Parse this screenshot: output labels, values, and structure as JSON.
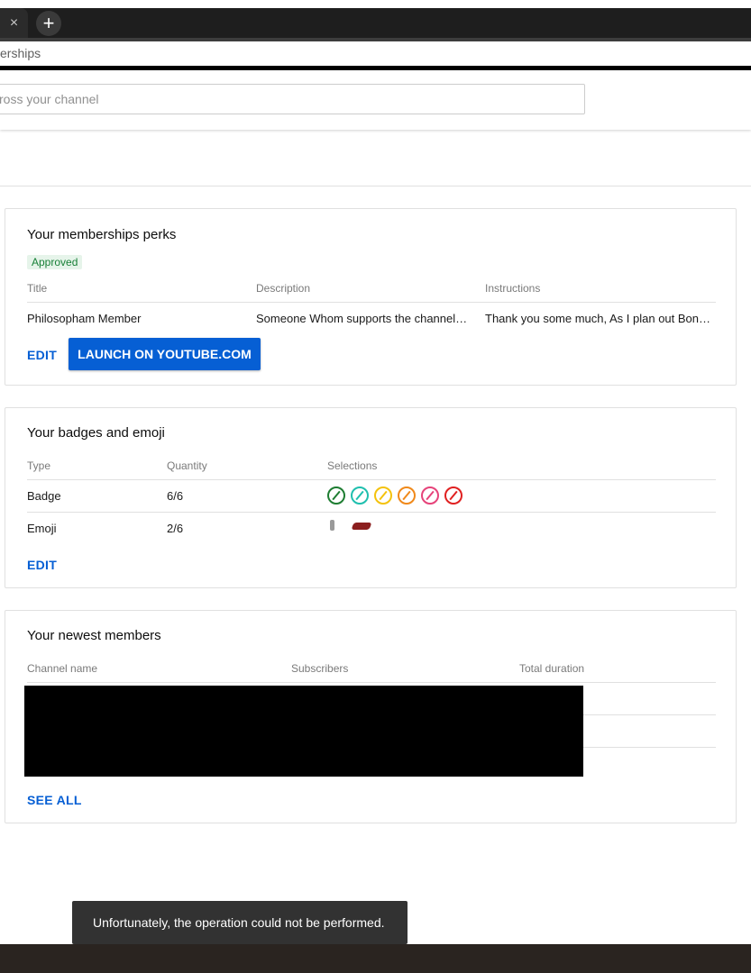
{
  "browser": {
    "close_tab_glyph": "×",
    "new_tab_glyph": "+",
    "address_fragment": "erships"
  },
  "header": {
    "search_placeholder": "ross your channel"
  },
  "perks": {
    "title": "Your memberships perks",
    "status": "Approved",
    "columns": [
      "Title",
      "Description",
      "Instructions"
    ],
    "row": [
      "Philosopham Member",
      "Someone Whom supports the channel…",
      "Thank you some much, As I plan out Bonu…"
    ],
    "edit_label": "EDIT",
    "launch_label": "LAUNCH ON YOUTUBE.COM"
  },
  "badges_emoji": {
    "title": "Your badges and emoji",
    "columns": [
      "Type",
      "Quantity",
      "Selections"
    ],
    "rows": [
      {
        "type": "Badge",
        "quantity": "6/6"
      },
      {
        "type": "Emoji",
        "quantity": "2/6"
      }
    ],
    "badge_colors": [
      "#1e7d32",
      "#1fbfae",
      "#f4c20d",
      "#f0891a",
      "#e6437a",
      "#e02020"
    ],
    "edit_label": "EDIT"
  },
  "members": {
    "title": "Your newest members",
    "columns": [
      "Channel name",
      "Subscribers",
      "Total duration"
    ],
    "see_all_label": "SEE ALL"
  },
  "toast": {
    "message": "Unfortunately, the operation could not be performed."
  },
  "colors": {
    "accent": "#065fd4",
    "approved_bg": "#e6f4ea",
    "approved_text": "#188038"
  }
}
